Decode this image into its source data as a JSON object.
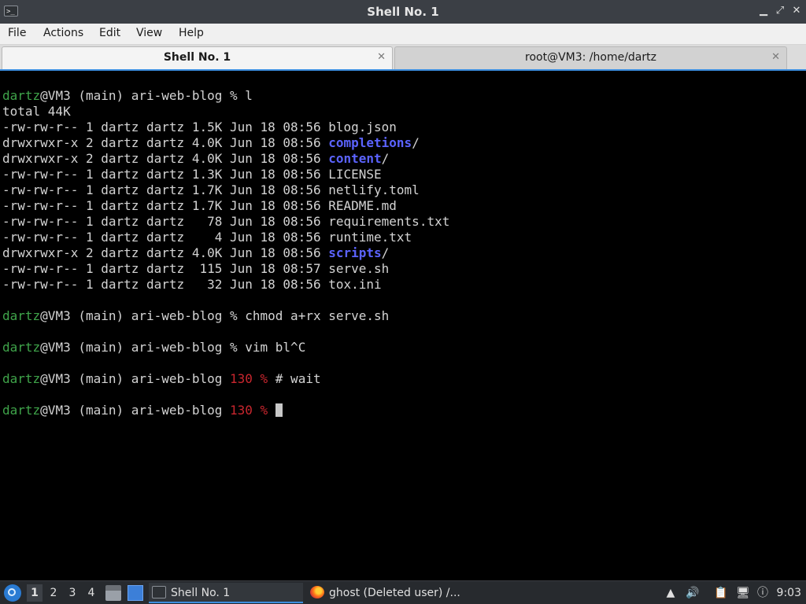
{
  "window": {
    "title": "Shell No. 1",
    "controls": {
      "minimize": "▁",
      "maximize": "⤢",
      "close": "✕"
    }
  },
  "menubar": {
    "file": "File",
    "actions": "Actions",
    "edit": "Edit",
    "view": "View",
    "help": "Help"
  },
  "tabs": [
    {
      "label": "Shell No. 1",
      "active": true,
      "close": "✕"
    },
    {
      "label": "root@VM3: /home/dartz",
      "active": false,
      "close": "✕"
    }
  ],
  "terminal": {
    "lines": [
      {
        "user": "dartz",
        "host": "@VM3 (main) ari-web-blog",
        "code": "",
        "sym": " %",
        "cmd": " l"
      },
      {
        "text": "total 44K"
      },
      {
        "meta": "-rw-rw-r-- 1 dartz dartz 1.5K Jun 18 08:56 ",
        "name": "blog.json",
        "dir": false
      },
      {
        "meta": "drwxrwxr-x 2 dartz dartz 4.0K Jun 18 08:56 ",
        "name": "completions",
        "dir": true,
        "suffix": "/"
      },
      {
        "meta": "drwxrwxr-x 2 dartz dartz 4.0K Jun 18 08:56 ",
        "name": "content",
        "dir": true,
        "suffix": "/"
      },
      {
        "meta": "-rw-rw-r-- 1 dartz dartz 1.3K Jun 18 08:56 ",
        "name": "LICENSE",
        "dir": false
      },
      {
        "meta": "-rw-rw-r-- 1 dartz dartz 1.7K Jun 18 08:56 ",
        "name": "netlify.toml",
        "dir": false
      },
      {
        "meta": "-rw-rw-r-- 1 dartz dartz 1.7K Jun 18 08:56 ",
        "name": "README.md",
        "dir": false
      },
      {
        "meta": "-rw-rw-r-- 1 dartz dartz   78 Jun 18 08:56 ",
        "name": "requirements.txt",
        "dir": false
      },
      {
        "meta": "-rw-rw-r-- 1 dartz dartz    4 Jun 18 08:56 ",
        "name": "runtime.txt",
        "dir": false
      },
      {
        "meta": "drwxrwxr-x 2 dartz dartz 4.0K Jun 18 08:56 ",
        "name": "scripts",
        "dir": true,
        "suffix": "/"
      },
      {
        "meta": "-rw-rw-r-- 1 dartz dartz  115 Jun 18 08:57 ",
        "name": "serve.sh",
        "dir": false
      },
      {
        "meta": "-rw-rw-r-- 1 dartz dartz   32 Jun 18 08:56 ",
        "name": "tox.ini",
        "dir": false
      },
      {
        "text": ""
      },
      {
        "user": "dartz",
        "host": "@VM3 (main) ari-web-blog",
        "code": "",
        "sym": " %",
        "cmd": " chmod a+rx serve.sh"
      },
      {
        "text": ""
      },
      {
        "user": "dartz",
        "host": "@VM3 (main) ari-web-blog",
        "code": "",
        "sym": " %",
        "cmd": " vim bl^C"
      },
      {
        "text": ""
      },
      {
        "user": "dartz",
        "host": "@VM3 (main) ari-web-blog",
        "code": " 130",
        "sym": " %",
        "cmd": " # wait"
      },
      {
        "text": ""
      },
      {
        "user": "dartz",
        "host": "@VM3 (main) ari-web-blog",
        "code": " 130",
        "sym": " %",
        "cmd": " ",
        "cursor": true
      }
    ],
    "colors": {
      "user": "#3fa44a",
      "error_code": "#c9262e",
      "directory": "#5b63ff",
      "text": "#d3d3d3",
      "background": "#000000"
    }
  },
  "taskbar": {
    "workspaces": [
      "1",
      "2",
      "3",
      "4"
    ],
    "current_workspace": "1",
    "tasks": [
      {
        "label": "Shell No. 1",
        "icon": "terminal-icon",
        "active": true
      },
      {
        "label": "ghost (Deleted user) /...",
        "icon": "firefox-icon",
        "active": false
      }
    ],
    "tray": {
      "up": "▲",
      "volume": "🔊",
      "clipboard": "📋",
      "network": "🖥",
      "updates": "ⓘ"
    },
    "clock": "9:03"
  },
  "accent": "#3d8fe0"
}
